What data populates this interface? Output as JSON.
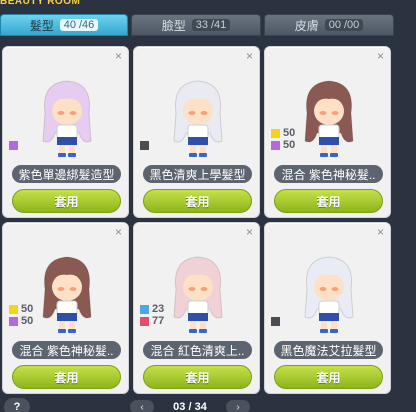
{
  "title": "BEAUTY ROOM",
  "tabs": [
    {
      "label": "髮型",
      "count": "40 /46",
      "active": true
    },
    {
      "label": "臉型",
      "count": "33 /41",
      "active": false
    },
    {
      "label": "皮膚",
      "count": "00 /00",
      "active": false
    }
  ],
  "cards": [
    {
      "name": "紫色單邊綁髮造型",
      "button": "套用",
      "close": "×",
      "swatches": [
        {
          "color": "#b36ae0",
          "value": ""
        }
      ],
      "hair": "#e6cdef"
    },
    {
      "name": "黑色清爽上學髮型",
      "button": "套用",
      "close": "×",
      "swatches": [
        {
          "color": "#4a4d52",
          "value": ""
        }
      ],
      "hair": "#e9eaf2"
    },
    {
      "name": "混合  紫色神秘髮..",
      "button": "套用",
      "close": "×",
      "swatches": [
        {
          "color": "#f5d318",
          "value": "50"
        },
        {
          "color": "#b36ae0",
          "value": "50"
        }
      ],
      "hair": "#8a5a52"
    },
    {
      "name": "混合  紫色神秘髮..",
      "button": "套用",
      "close": "×",
      "swatches": [
        {
          "color": "#f5d318",
          "value": "50"
        },
        {
          "color": "#b36ae0",
          "value": "50"
        }
      ],
      "hair": "#8a5a52"
    },
    {
      "name": "混合  紅色清爽上..",
      "button": "套用",
      "close": "×",
      "swatches": [
        {
          "color": "#4aa8e8",
          "value": "23"
        },
        {
          "color": "#e0506a",
          "value": "77"
        }
      ],
      "hair": "#f0d2d6"
    },
    {
      "name": "黑色魔法艾拉髮型",
      "button": "套用",
      "close": "×",
      "swatches": [
        {
          "color": "#4a4d52",
          "value": ""
        }
      ],
      "hair": "#e9ecf4"
    }
  ],
  "pager": {
    "prev": "‹",
    "next": "›",
    "text": "03 / 34"
  },
  "help": "?"
}
